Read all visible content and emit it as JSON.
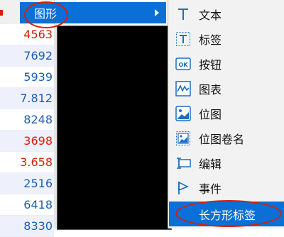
{
  "colors": {
    "accent": "#0a6fd6",
    "annotation_red": "#d81e06",
    "number_red": "#d81e06",
    "number_blue": "#1a5fb4"
  },
  "number_column": [
    {
      "text": "4563",
      "color": "red"
    },
    {
      "text": "7692",
      "color": "blue"
    },
    {
      "text": "5939",
      "color": "blue"
    },
    {
      "text": "7.812",
      "color": "blue"
    },
    {
      "text": "8248",
      "color": "blue"
    },
    {
      "text": "3698",
      "color": "red"
    },
    {
      "text": "3.658",
      "color": "red"
    },
    {
      "text": "2516",
      "color": "blue"
    },
    {
      "text": "6418",
      "color": "blue"
    },
    {
      "text": "8330",
      "color": "blue"
    }
  ],
  "parent_menu": {
    "label": "图形",
    "arrow_icon": "chevron-right-icon"
  },
  "submenu": {
    "items": [
      {
        "label": "文本",
        "icon": "text-icon"
      },
      {
        "label": "标签",
        "icon": "label-icon"
      },
      {
        "label": "按钮",
        "icon": "ok-button-icon"
      },
      {
        "label": "图表",
        "icon": "chart-icon"
      },
      {
        "label": "位图",
        "icon": "image-icon"
      },
      {
        "label": "位图卷名",
        "icon": "image-name-icon"
      },
      {
        "label": "编辑",
        "icon": "edit-field-icon"
      },
      {
        "label": "事件",
        "icon": "flag-icon"
      },
      {
        "label": "长方形标签",
        "icon": "rect-label-icon",
        "selected": true
      }
    ]
  },
  "ok_icon_text": "OK"
}
